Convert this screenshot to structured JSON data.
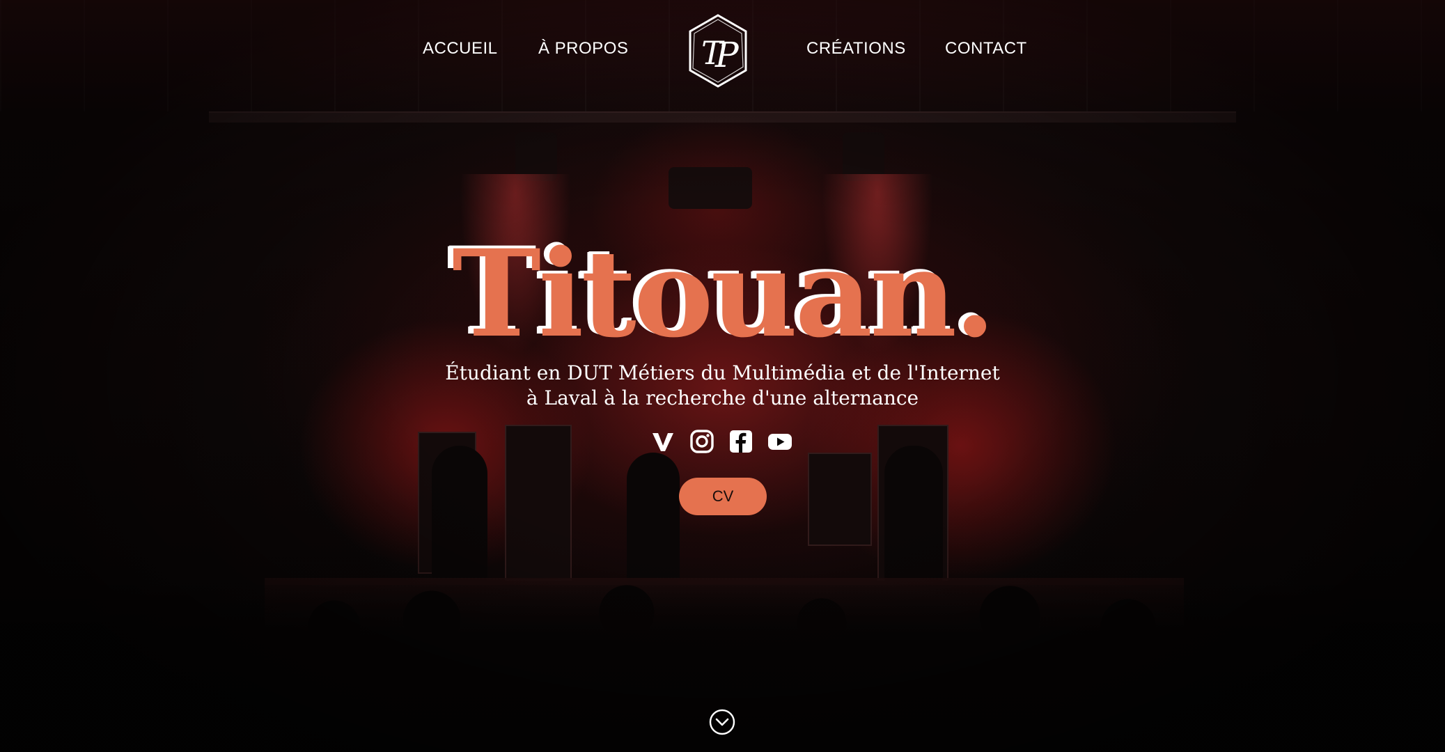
{
  "nav": {
    "items": [
      {
        "label": "ACCUEIL"
      },
      {
        "label": "À PROPOS"
      },
      {
        "label": "CRÉATIONS"
      },
      {
        "label": "CONTACT"
      }
    ],
    "logo_icon": "tp-monogram-hexagon-logo"
  },
  "hero": {
    "title": "Titouan.",
    "subtitle_line1": "Étudiant en DUT Métiers du Multimédia et de l'Internet",
    "subtitle_line2": "à Laval à la recherche d'une alternance"
  },
  "socials": [
    {
      "icon": "vimeo-icon"
    },
    {
      "icon": "instagram-icon"
    },
    {
      "icon": "facebook-icon"
    },
    {
      "icon": "youtube-icon"
    }
  ],
  "cv_button": {
    "label": "CV"
  },
  "scroll": {
    "icon": "chevron-down-circle-icon"
  },
  "colors": {
    "accent": "#e5724f",
    "text": "#ffffff",
    "background": "#0b0707"
  },
  "background": {
    "icon": "concert-stage-photo"
  }
}
